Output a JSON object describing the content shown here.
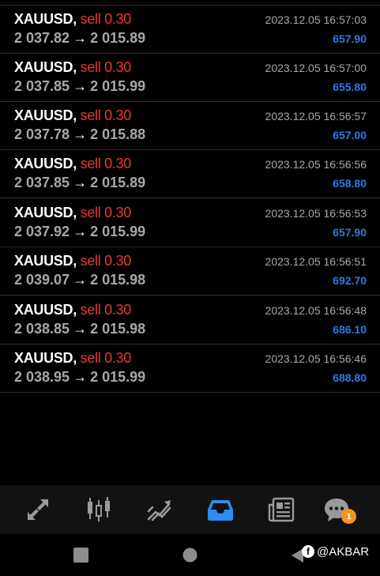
{
  "trades": [
    {
      "symbol": "XAUUSD,",
      "side": "sell 0.30",
      "open_price": "2 037.82",
      "close_price": "2 015.89",
      "time": "2023.12.05 16:57:03",
      "profit": "657.90"
    },
    {
      "symbol": "XAUUSD,",
      "side": "sell 0.30",
      "open_price": "2 037.85",
      "close_price": "2 015.99",
      "time": "2023.12.05 16:57:00",
      "profit": "655.80"
    },
    {
      "symbol": "XAUUSD,",
      "side": "sell 0.30",
      "open_price": "2 037.78",
      "close_price": "2 015.88",
      "time": "2023.12.05 16:56:57",
      "profit": "657.00"
    },
    {
      "symbol": "XAUUSD,",
      "side": "sell 0.30",
      "open_price": "2 037.85",
      "close_price": "2 015.89",
      "time": "2023.12.05 16:56:56",
      "profit": "658.80"
    },
    {
      "symbol": "XAUUSD,",
      "side": "sell 0.30",
      "open_price": "2 037.92",
      "close_price": "2 015.99",
      "time": "2023.12.05 16:56:53",
      "profit": "657.90"
    },
    {
      "symbol": "XAUUSD,",
      "side": "sell 0.30",
      "open_price": "2 039.07",
      "close_price": "2 015.98",
      "time": "2023.12.05 16:56:51",
      "profit": "692.70"
    },
    {
      "symbol": "XAUUSD,",
      "side": "sell 0.30",
      "open_price": "2 038.85",
      "close_price": "2 015.98",
      "time": "2023.12.05 16:56:48",
      "profit": "686.10"
    },
    {
      "symbol": "XAUUSD,",
      "side": "sell 0.30",
      "open_price": "2 038.95",
      "close_price": "2 015.99",
      "time": "2023.12.05 16:56:46",
      "profit": "688.80"
    }
  ],
  "arrow_glyph": "→",
  "tabbar": {
    "tabs": [
      {
        "icon": "quotes-arrows-icon",
        "active": false
      },
      {
        "icon": "candlestick-chart-icon",
        "active": false
      },
      {
        "icon": "trade-chart-icon",
        "active": false
      },
      {
        "icon": "history-inbox-icon",
        "active": true
      },
      {
        "icon": "news-icon",
        "active": false
      },
      {
        "icon": "chat-icon",
        "active": false
      }
    ],
    "chat_badge": "1"
  },
  "watermark": {
    "text": "@AKBAR",
    "icon": "facebook-icon"
  },
  "colors": {
    "background": "#000000",
    "sell": "#e53935",
    "profit": "#2f7ae5",
    "muted_text": "#a8a8a8",
    "active_tab": "#2f8cf0",
    "inactive_tab": "#9a9a9a",
    "badge": "#f7931e"
  }
}
